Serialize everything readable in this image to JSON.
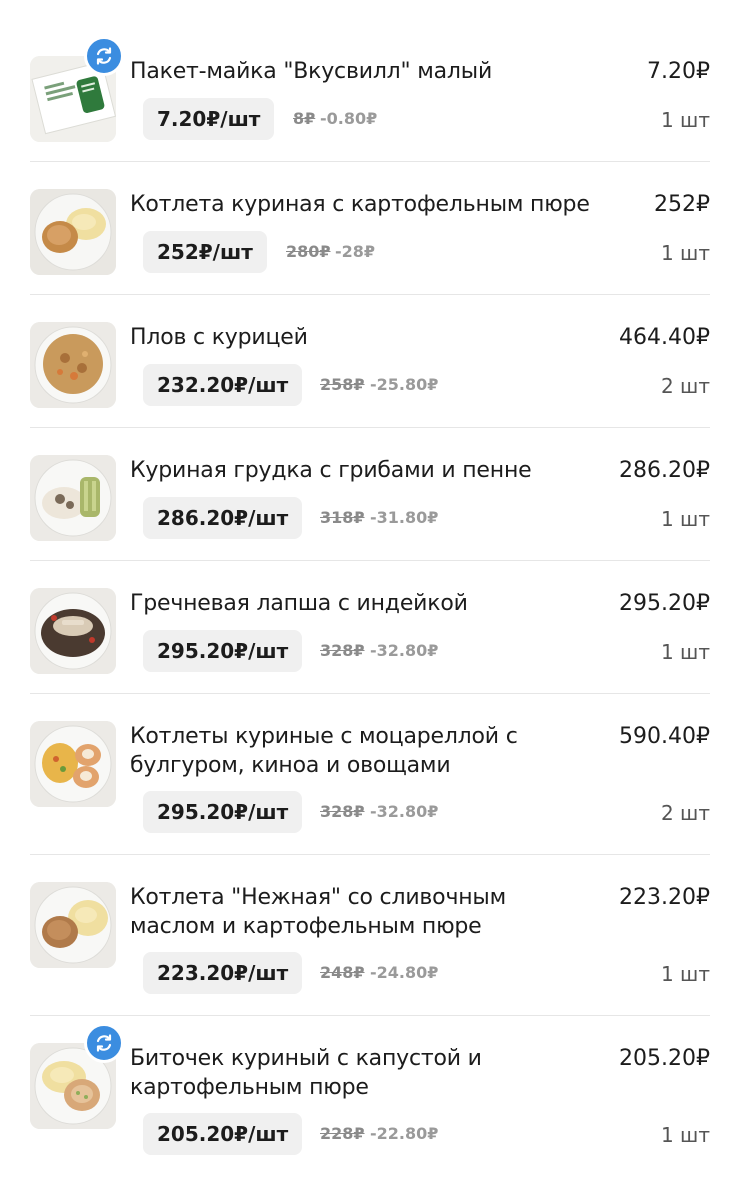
{
  "items": [
    {
      "name": "Пакет-майка \"Вкусвилл\" малый",
      "total": "7.20₽",
      "unit_price": "7.20₽/шт",
      "old_price": "8₽",
      "discount": "-0.80₽",
      "qty": "1 шт",
      "has_swap": true,
      "thumb": "bag-image"
    },
    {
      "name": "Котлета куриная с картофельным пюре",
      "total": "252₽",
      "unit_price": "252₽/шт",
      "old_price": "280₽",
      "discount": "-28₽",
      "qty": "1 шт",
      "has_swap": false,
      "thumb": "cutlet-mash-image"
    },
    {
      "name": "Плов с курицей",
      "total": "464.40₽",
      "unit_price": "232.20₽/шт",
      "old_price": "258₽",
      "discount": "-25.80₽",
      "qty": "2 шт",
      "has_swap": false,
      "thumb": "pilaf-image"
    },
    {
      "name": "Куриная грудка с грибами и пенне",
      "total": "286.20₽",
      "unit_price": "286.20₽/шт",
      "old_price": "318₽",
      "discount": "-31.80₽",
      "qty": "1 шт",
      "has_swap": false,
      "thumb": "chicken-penne-image"
    },
    {
      "name": "Гречневая лапша с индейкой",
      "total": "295.20₽",
      "unit_price": "295.20₽/шт",
      "old_price": "328₽",
      "discount": "-32.80₽",
      "qty": "1 шт",
      "has_swap": false,
      "thumb": "buckwheat-noodles-image"
    },
    {
      "name": "Котлеты куриные с моцареллой с булгуром, киноа и овощами",
      "total": "590.40₽",
      "unit_price": "295.20₽/шт",
      "old_price": "328₽",
      "discount": "-32.80₽",
      "qty": "2 шт",
      "has_swap": false,
      "thumb": "cutlets-bulgur-image"
    },
    {
      "name": "Котлета \"Нежная\" со сливочным маслом и картофельным пюре",
      "total": "223.20₽",
      "unit_price": "223.20₽/шт",
      "old_price": "248₽",
      "discount": "-24.80₽",
      "qty": "1 шт",
      "has_swap": false,
      "thumb": "tender-cutlet-image"
    },
    {
      "name": "Биточек куриный с капустой и картофельным пюре",
      "total": "205.20₽",
      "unit_price": "205.20₽/шт",
      "old_price": "228₽",
      "discount": "-22.80₽",
      "qty": "1 шт",
      "has_swap": true,
      "thumb": "patty-cabbage-image"
    }
  ],
  "colors": {
    "accent": "#3b8de0",
    "pill_bg": "#f0f0f0",
    "muted": "#8a8a8a"
  },
  "icons": {
    "swap": "swap-arrows-icon"
  }
}
